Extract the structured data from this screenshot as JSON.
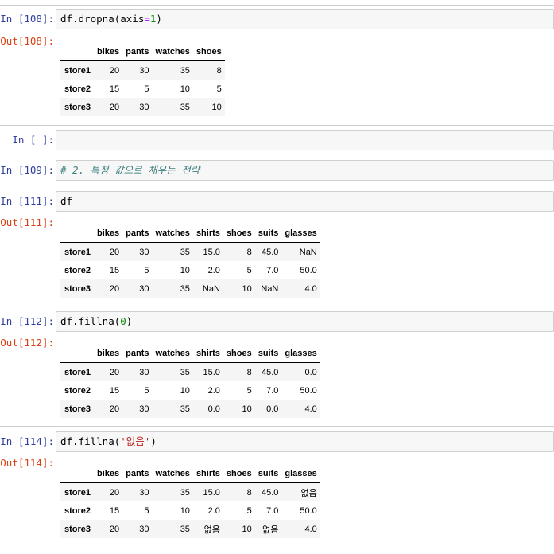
{
  "cells": [
    {
      "in_prompt": "In [108]:",
      "code": [
        {
          "t": "df.dropna(axis"
        },
        {
          "t": "=",
          "c": "op"
        },
        {
          "t": "1",
          "c": "num"
        },
        {
          "t": ")"
        }
      ],
      "out_prompt": "Out[108]:",
      "table": {
        "columns": [
          "",
          "bikes",
          "pants",
          "watches",
          "shoes"
        ],
        "rows": [
          [
            "store1",
            "20",
            "30",
            "35",
            "8"
          ],
          [
            "store2",
            "15",
            "5",
            "10",
            "5"
          ],
          [
            "store3",
            "20",
            "30",
            "35",
            "10"
          ]
        ]
      }
    },
    {
      "in_prompt": "In [ ]:",
      "code": []
    },
    {
      "in_prompt": "In [109]:",
      "code": [
        {
          "t": "# 2. 특정 값으로 채우는 전략",
          "c": "comment"
        }
      ]
    },
    {
      "in_prompt": "In [111]:",
      "code": [
        {
          "t": "df"
        }
      ],
      "out_prompt": "Out[111]:",
      "table": {
        "columns": [
          "",
          "bikes",
          "pants",
          "watches",
          "shirts",
          "shoes",
          "suits",
          "glasses"
        ],
        "rows": [
          [
            "store1",
            "20",
            "30",
            "35",
            "15.0",
            "8",
            "45.0",
            "NaN"
          ],
          [
            "store2",
            "15",
            "5",
            "10",
            "2.0",
            "5",
            "7.0",
            "50.0"
          ],
          [
            "store3",
            "20",
            "30",
            "35",
            "NaN",
            "10",
            "NaN",
            "4.0"
          ]
        ]
      }
    },
    {
      "in_prompt": "In [112]:",
      "code": [
        {
          "t": "df.fillna("
        },
        {
          "t": "0",
          "c": "num"
        },
        {
          "t": ")"
        }
      ],
      "out_prompt": "Out[112]:",
      "table": {
        "columns": [
          "",
          "bikes",
          "pants",
          "watches",
          "shirts",
          "shoes",
          "suits",
          "glasses"
        ],
        "rows": [
          [
            "store1",
            "20",
            "30",
            "35",
            "15.0",
            "8",
            "45.0",
            "0.0"
          ],
          [
            "store2",
            "15",
            "5",
            "10",
            "2.0",
            "5",
            "7.0",
            "50.0"
          ],
          [
            "store3",
            "20",
            "30",
            "35",
            "0.0",
            "10",
            "0.0",
            "4.0"
          ]
        ]
      }
    },
    {
      "in_prompt": "In [114]:",
      "code": [
        {
          "t": "df.fillna("
        },
        {
          "t": "'없음'",
          "c": "str"
        },
        {
          "t": ")"
        }
      ],
      "out_prompt": "Out[114]:",
      "table": {
        "columns": [
          "",
          "bikes",
          "pants",
          "watches",
          "shirts",
          "shoes",
          "suits",
          "glasses"
        ],
        "rows": [
          [
            "store1",
            "20",
            "30",
            "35",
            "15.0",
            "8",
            "45.0",
            "없음"
          ],
          [
            "store2",
            "15",
            "5",
            "10",
            "2.0",
            "5",
            "7.0",
            "50.0"
          ],
          [
            "store3",
            "20",
            "30",
            "35",
            "없음",
            "10",
            "없음",
            "4.0"
          ]
        ]
      }
    }
  ]
}
